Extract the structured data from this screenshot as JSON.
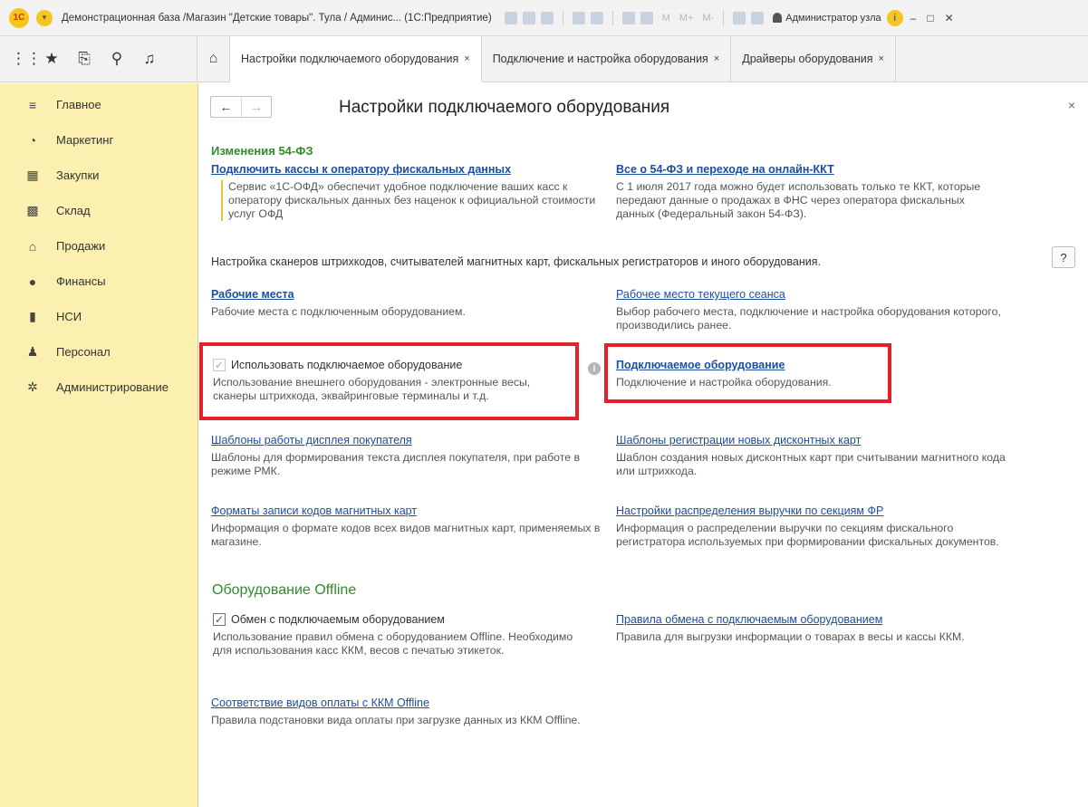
{
  "app": {
    "logo": "1С",
    "window_title": "Демонстрационная база /Магазин \"Детские товары\". Тула / Админис... (1С:Предприятие)",
    "memory_buttons": [
      "M",
      "M+",
      "M-"
    ],
    "user": "Администратор узла",
    "info_label": "i",
    "minimize": "–",
    "restore": "□",
    "close": "✕"
  },
  "nav": {
    "home_icon": "⌂",
    "tabs": [
      {
        "label": "Настройки подключаемого оборудования",
        "close": "×"
      },
      {
        "label": "Подключение и настройка оборудования",
        "close": "×"
      },
      {
        "label": "Драйверы оборудования",
        "close": "×"
      }
    ]
  },
  "sidebar": {
    "items": [
      {
        "label": "Главное",
        "icon": "≡"
      },
      {
        "label": "Маркетинг",
        "icon": "◔"
      },
      {
        "label": "Закупки",
        "icon": "▦"
      },
      {
        "label": "Склад",
        "icon": "▩"
      },
      {
        "label": "Продажи",
        "icon": "⌂"
      },
      {
        "label": "Финансы",
        "icon": "●"
      },
      {
        "label": "НСИ",
        "icon": "▮"
      },
      {
        "label": "Персонал",
        "icon": "♟"
      },
      {
        "label": "Администрирование",
        "icon": "✲"
      }
    ]
  },
  "page": {
    "back": "←",
    "forward": "→",
    "title": "Настройки подключаемого оборудования",
    "close": "×",
    "help": "?",
    "fz_header": "Изменения 54-ФЗ",
    "fz_left_link": "Подключить кассы к оператору фискальных данных",
    "fz_left_desc": "Сервис «1С-ОФД» обеспечит удобное подключение ваших касс к оператору фискальных данных без наценок к официальной стоимости услуг ОФД",
    "fz_right_link": "Все о 54-ФЗ и переходе на онлайн-ККТ",
    "fz_right_desc": "С 1 июля 2017 года можно будет использовать только те ККТ, которые передают данные о продажах в ФНС через оператора фискальных данных (Федеральный закон 54-ФЗ).",
    "intro": "Настройка сканеров штрихкодов, считывателей магнитных карт, фискальных регистраторов и иного оборудования.",
    "workplaces_link": "Рабочие места",
    "workplaces_desc": "Рабочие места с подключенным оборудованием.",
    "current_wp_link": "Рабочее место текущего сеанса",
    "current_wp_desc": "Выбор рабочего места, подключение и настройка оборудования которого, производились ранее.",
    "use_equipment_check": "✓",
    "use_equipment_label": "Использовать подключаемое оборудование",
    "use_equipment_desc": "Использование внешнего оборудования - электронные весы, сканеры штрихкода, эквайринговые терминалы и т.д.",
    "info_i": "i",
    "equipment_link": "Подключаемое оборудование",
    "equipment_desc": "Подключение и настройка оборудования.",
    "display_link": "Шаблоны работы дисплея покупателя",
    "display_desc": "Шаблоны для формирования текста дисплея покупателя, при работе в режиме РМК.",
    "discount_link": "Шаблоны регистрации новых дисконтных карт",
    "discount_desc": "Шаблон создания новых дисконтных карт при считывании магнитного кода или штрихкода.",
    "magcard_link": "Форматы записи кодов магнитных карт",
    "magcard_desc": "Информация о формате кодов всех видов магнитных карт, применяемых в магазине.",
    "revenue_link": "Настройки распределения выручки по секциям ФР",
    "revenue_desc": "Информация о распределении выручки по секциям фискального регистратора используемых при формировании фискальных документов.",
    "offline_header": "Оборудование Offline",
    "exchange_check": "✓",
    "exchange_label": "Обмен с подключаемым оборудованием",
    "exchange_desc": "Использование правил обмена с оборудованием Offline. Необходимо для использования касс ККМ, весов с печатью этикеток.",
    "exchange_rules_link": "Правила обмена с подключаемым оборудованием",
    "exchange_rules_desc": "Правила для выгрузки информации о товарах в весы и кассы ККМ.",
    "payment_link": "Соответствие видов оплаты с ККМ Offline",
    "payment_desc": "Правила подстановки вида оплаты при загрузке данных из ККМ Offline."
  },
  "colors": {
    "sidebar_bg": "#fbf0b0",
    "link": "#1c4ea1",
    "section_green": "#2e8b2e",
    "highlight_red": "#e5202b"
  }
}
